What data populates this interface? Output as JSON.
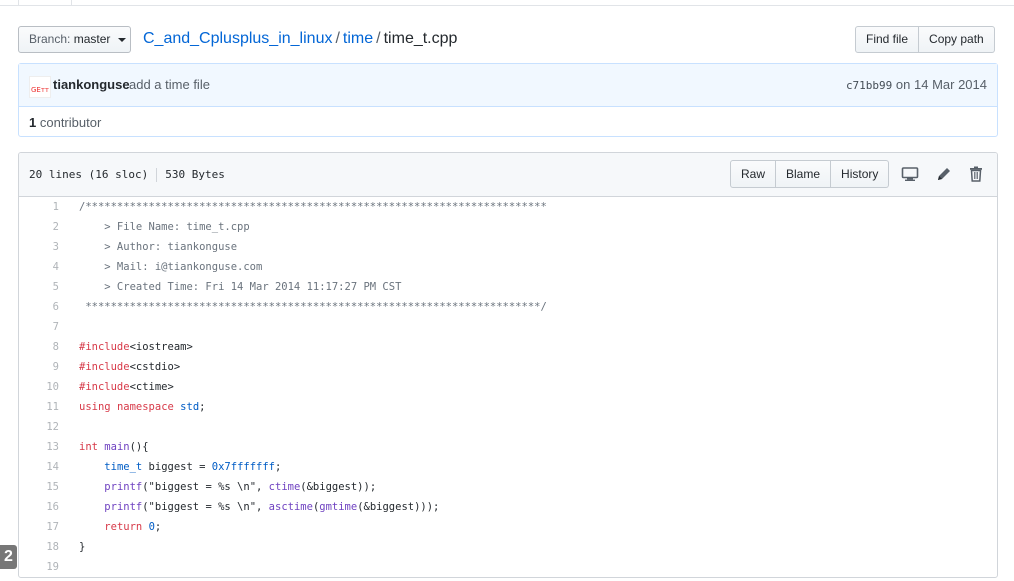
{
  "branch": {
    "prefix": "Branch:",
    "name": "master"
  },
  "breadcrumb": {
    "repo": "C_and_Cplusplus_in_linux",
    "sep1": "/",
    "dir": "time",
    "sep2": "/",
    "file": "time_t.cpp"
  },
  "file_actions": {
    "find_file": "Find file",
    "copy_path": "Copy path"
  },
  "commit": {
    "avatar_text": "ǤEтт",
    "author": "tiankonguse",
    "message": "add a time file",
    "sha": "c71bb99",
    "date_text": "on 14 Mar 2014"
  },
  "contributors": {
    "count": "1",
    "label": "contributor"
  },
  "file_header": {
    "lines": "20 lines (16 sloc)",
    "size": "530 Bytes"
  },
  "file_buttons": {
    "raw": "Raw",
    "blame": "Blame",
    "history": "History"
  },
  "icons": {
    "desktop": "desktop-icon",
    "edit": "pencil-icon",
    "delete": "trash-icon"
  },
  "code_lines": [
    "/*************************************************************************",
    "    > File Name: time_t.cpp",
    "    > Author: tiankonguse",
    "    > Mail: i@tiankonguse.com",
    "    > Created Time: Fri 14 Mar 2014 11:17:27 PM CST",
    " ************************************************************************/",
    "",
    "#include<iostream>",
    "#include<cstdio>",
    "#include<ctime>",
    "using namespace std;",
    "",
    "int main(){",
    "    time_t biggest = 0x7fffffff;",
    "    printf(\"biggest = %s \\n\", ctime(&biggest));",
    "    printf(\"biggest = %s \\n\", asctime(gmtime(&biggest)));",
    "    return 0;",
    "}",
    ""
  ],
  "corner_badge": "2",
  "colors": {
    "link": "#0366d6",
    "keyword": "#d73a49",
    "function": "#6f42c1",
    "number": "#005cc5",
    "string": "#032f62",
    "comment": "#6a737d",
    "commit_bg": "#f1f8ff"
  }
}
